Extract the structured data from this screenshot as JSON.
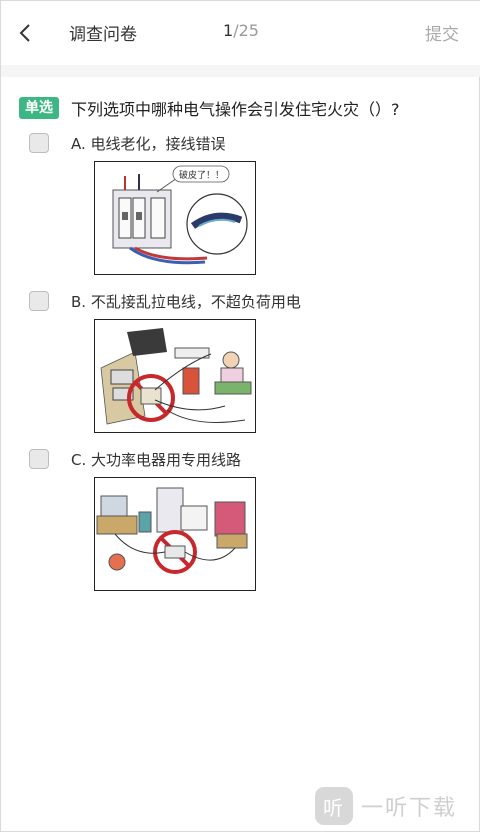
{
  "nav": {
    "back_icon": "chevron-left-icon",
    "title": "调查问卷",
    "progress_current": "1",
    "progress_total": "/25",
    "submit_label": "提交"
  },
  "question": {
    "type_tag": "单选",
    "text": "下列选项中哪种电气操作会引发住宅火灾（）?"
  },
  "options": [
    {
      "label": "A.  电线老化，接线错误",
      "illustration_caption": "破皮了！！"
    },
    {
      "label": "B.  不乱接乱拉电线，不超负荷用电",
      "illustration_caption": ""
    },
    {
      "label": "C.  大功率电器用专用线路",
      "illustration_caption": ""
    }
  ],
  "watermark": {
    "logo_glyph": "听",
    "text": "一听下载"
  },
  "colors": {
    "accent": "#3cb783",
    "muted": "#aaaaaa",
    "prohibit": "#c6282b"
  }
}
